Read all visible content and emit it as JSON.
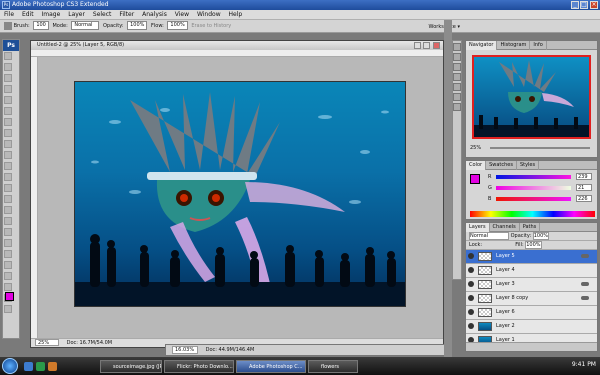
{
  "app": {
    "title": "Adobe Photoshop CS3 Extended",
    "icon": "ps-icon",
    "window_buttons": [
      "minimize-icon",
      "maximize-icon",
      "close-icon"
    ]
  },
  "menubar": [
    "File",
    "Edit",
    "Image",
    "Layer",
    "Select",
    "Filter",
    "Analysis",
    "View",
    "Window",
    "Help"
  ],
  "options": {
    "brush_label": "Brush:",
    "brush_size": "100",
    "mode_label": "Mode:",
    "mode_value": "Normal",
    "opacity_label": "Opacity:",
    "opacity_value": "100%",
    "flow_label": "Flow:",
    "flow_value": "100%",
    "history_label": "Erase to History",
    "workspace_label": "Workspace"
  },
  "document": {
    "title": "Untitled-2 @ 25% (Layer 5, RGB/8)",
    "zoom": "25%",
    "status": "Doc: 16.7M/54.0M"
  },
  "document2": {
    "zoom": "16.03%",
    "status": "Doc: 44.9M/146.4M"
  },
  "navigator": {
    "tabs": [
      "Navigator",
      "Histogram",
      "Info"
    ],
    "zoom": "25%"
  },
  "color": {
    "tabs": [
      "Color",
      "Swatches",
      "Styles"
    ],
    "r_label": "R",
    "r_value": "239",
    "g_label": "G",
    "g_value": "21",
    "b_label": "B",
    "b_value": "226",
    "foreground": "#e000e0"
  },
  "layers": {
    "tabs": [
      "Layers",
      "Channels",
      "Paths"
    ],
    "blend_mode": "Normal",
    "opacity_label": "Opacity:",
    "opacity_value": "100%",
    "lock_label": "Lock:",
    "fill_label": "Fill:",
    "fill_value": "100%",
    "items": [
      {
        "name": "Layer 5",
        "selected": true
      },
      {
        "name": "Layer 4"
      },
      {
        "name": "Layer 3"
      },
      {
        "name": "Layer 8 copy"
      },
      {
        "name": "Layer 6"
      },
      {
        "name": "Layer 2"
      },
      {
        "name": "Layer 1"
      }
    ]
  },
  "taskbar": {
    "buttons": [
      "sourceimage.jpg (JP...",
      "Flickr: Photo Downlo...",
      "Adobe Photoshop C...",
      "flowers"
    ],
    "clock": "9:41 PM"
  }
}
